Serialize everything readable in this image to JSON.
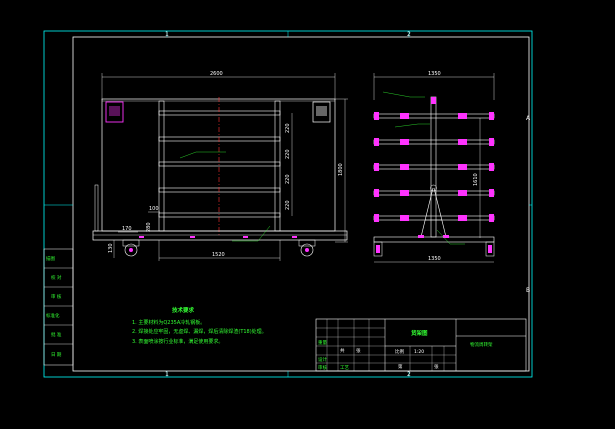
{
  "zones": {
    "top_1": "1",
    "top_2": "2",
    "bottom_1": "1",
    "bottom_2": "2",
    "right_a": "A",
    "right_b": "B"
  },
  "front_view": {
    "width": "2600",
    "height": "1800",
    "shelf_gaps": [
      "220",
      "220",
      "220",
      "220"
    ],
    "bottom_span": "1520",
    "left_small_1": "100",
    "left_small_2": "170",
    "left_small_3": "130",
    "bottom_height": "280"
  },
  "side_view": {
    "title": "俯视图",
    "top_width": "1350",
    "bottom_width": "1350",
    "height": "1610"
  },
  "notes": {
    "heading": "技术要求",
    "lines": [
      "1. 主要材料为Q235A冷轧钢板。",
      "2. 焊接处应牢固，无虚焊、漏焊，焊后清除焊渣(T18)处理。",
      "3. 表面喷涂按行业标准，满足使用要求。"
    ]
  },
  "left_strip": [
    "描图",
    "校 对",
    "审 核",
    "标准化",
    "批 准",
    "日 期"
  ],
  "title_block": {
    "drawing_name": "货架图",
    "drawing_no": "物流周转架",
    "scale_row": [
      "比例",
      "1:20"
    ],
    "cells": [
      "重量",
      "共",
      "张",
      "第",
      "张",
      "设计",
      "审核",
      "工艺"
    ]
  },
  "colors": {
    "frame": "#00ffff",
    "outline": "#ffffff",
    "text": "#33ff33",
    "accent": "#ff33ff",
    "center": "#ff3333"
  }
}
